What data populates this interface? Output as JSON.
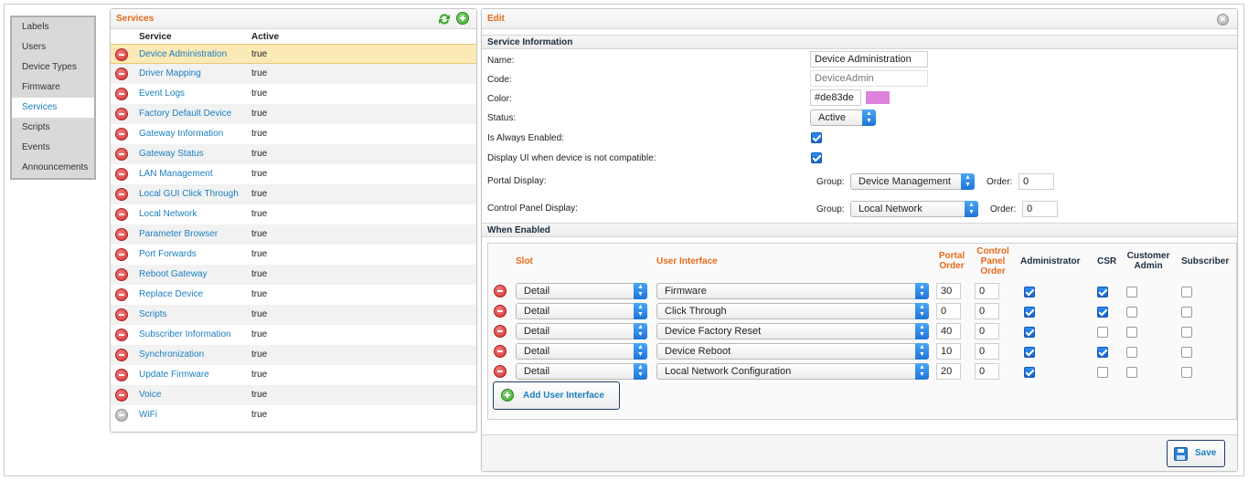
{
  "nav": {
    "items": [
      {
        "label": "Labels",
        "active": false
      },
      {
        "label": "Users",
        "active": false
      },
      {
        "label": "Device Types",
        "active": false
      },
      {
        "label": "Firmware",
        "active": false
      },
      {
        "label": "Services",
        "active": true
      },
      {
        "label": "Scripts",
        "active": false
      },
      {
        "label": "Events",
        "active": false
      },
      {
        "label": "Announcements",
        "active": false
      }
    ]
  },
  "services": {
    "title": "Services",
    "col_service": "Service",
    "col_active": "Active",
    "rows": [
      {
        "name": "Device Administration",
        "active": "true",
        "selected": true,
        "icon": "remove-icon"
      },
      {
        "name": "Driver Mapping",
        "active": "true",
        "icon": "remove-icon"
      },
      {
        "name": "Event Logs",
        "active": "true",
        "icon": "remove-icon"
      },
      {
        "name": "Factory Default Device",
        "active": "true",
        "icon": "remove-icon"
      },
      {
        "name": "Gateway Information",
        "active": "true",
        "icon": "remove-icon"
      },
      {
        "name": "Gateway Status",
        "active": "true",
        "icon": "remove-icon"
      },
      {
        "name": "LAN Management",
        "active": "true",
        "icon": "remove-icon"
      },
      {
        "name": "Local GUI Click Through",
        "active": "true",
        "icon": "remove-icon"
      },
      {
        "name": "Local Network",
        "active": "true",
        "icon": "remove-icon"
      },
      {
        "name": "Parameter Browser",
        "active": "true",
        "icon": "remove-icon"
      },
      {
        "name": "Port Forwards",
        "active": "true",
        "icon": "remove-icon"
      },
      {
        "name": "Reboot Gateway",
        "active": "true",
        "icon": "remove-icon"
      },
      {
        "name": "Replace Device",
        "active": "true",
        "icon": "remove-icon"
      },
      {
        "name": "Scripts",
        "active": "true",
        "icon": "remove-icon"
      },
      {
        "name": "Subscriber Information",
        "active": "true",
        "icon": "remove-icon"
      },
      {
        "name": "Synchronization",
        "active": "true",
        "icon": "remove-icon"
      },
      {
        "name": "Update Firmware",
        "active": "true",
        "icon": "remove-icon"
      },
      {
        "name": "Voice",
        "active": "true",
        "icon": "remove-icon"
      },
      {
        "name": "WiFi",
        "active": "true",
        "icon": "remove-disabled-icon"
      }
    ]
  },
  "edit": {
    "title": "Edit",
    "section_info": "Service Information",
    "name_label": "Name:",
    "name_value": "Device Administration",
    "code_label": "Code:",
    "code_value": "DeviceAdmin",
    "color_label": "Color:",
    "color_value": "#de83de",
    "color_swatch": "#de83de",
    "status_label": "Status:",
    "status_value": "Active",
    "always_enabled_label": "Is Always Enabled:",
    "always_enabled": true,
    "display_ui_label": "Display UI when device is not compatible:",
    "display_ui": true,
    "portal_display_label": "Portal Display:",
    "portal_group_label": "Group:",
    "portal_group_value": "Device Management",
    "portal_order_label": "Order:",
    "portal_order_value": "0",
    "cp_display_label": "Control Panel Display:",
    "cp_group_label": "Group:",
    "cp_group_value": "Local Network",
    "cp_order_label": "Order:",
    "cp_order_value": "0",
    "section_enabled": "When Enabled",
    "table": {
      "h_slot": "Slot",
      "h_ui": "User Interface",
      "h_portal_order": "Portal Order",
      "h_cp_order": "Control Panel Order",
      "h_admin": "Administrator",
      "h_csr": "CSR",
      "h_customer_admin": "Customer Admin",
      "h_subscriber": "Subscriber",
      "rows": [
        {
          "slot": "Detail",
          "ui": "Firmware",
          "portal_order": "30",
          "cp_order": "0",
          "admin": true,
          "csr": true,
          "customer_admin": false,
          "subscriber": false
        },
        {
          "slot": "Detail",
          "ui": "Click Through",
          "portal_order": "0",
          "cp_order": "0",
          "admin": true,
          "csr": true,
          "customer_admin": false,
          "subscriber": false
        },
        {
          "slot": "Detail",
          "ui": "Device Factory Reset",
          "portal_order": "40",
          "cp_order": "0",
          "admin": true,
          "csr": false,
          "customer_admin": false,
          "subscriber": false
        },
        {
          "slot": "Detail",
          "ui": "Device Reboot",
          "portal_order": "10",
          "cp_order": "0",
          "admin": true,
          "csr": true,
          "customer_admin": false,
          "subscriber": false
        },
        {
          "slot": "Detail",
          "ui": "Local Network Configuration",
          "portal_order": "20",
          "cp_order": "0",
          "admin": true,
          "csr": false,
          "customer_admin": false,
          "subscriber": false
        }
      ]
    },
    "add_ui_label": "Add User Interface",
    "save_label": "Save"
  }
}
